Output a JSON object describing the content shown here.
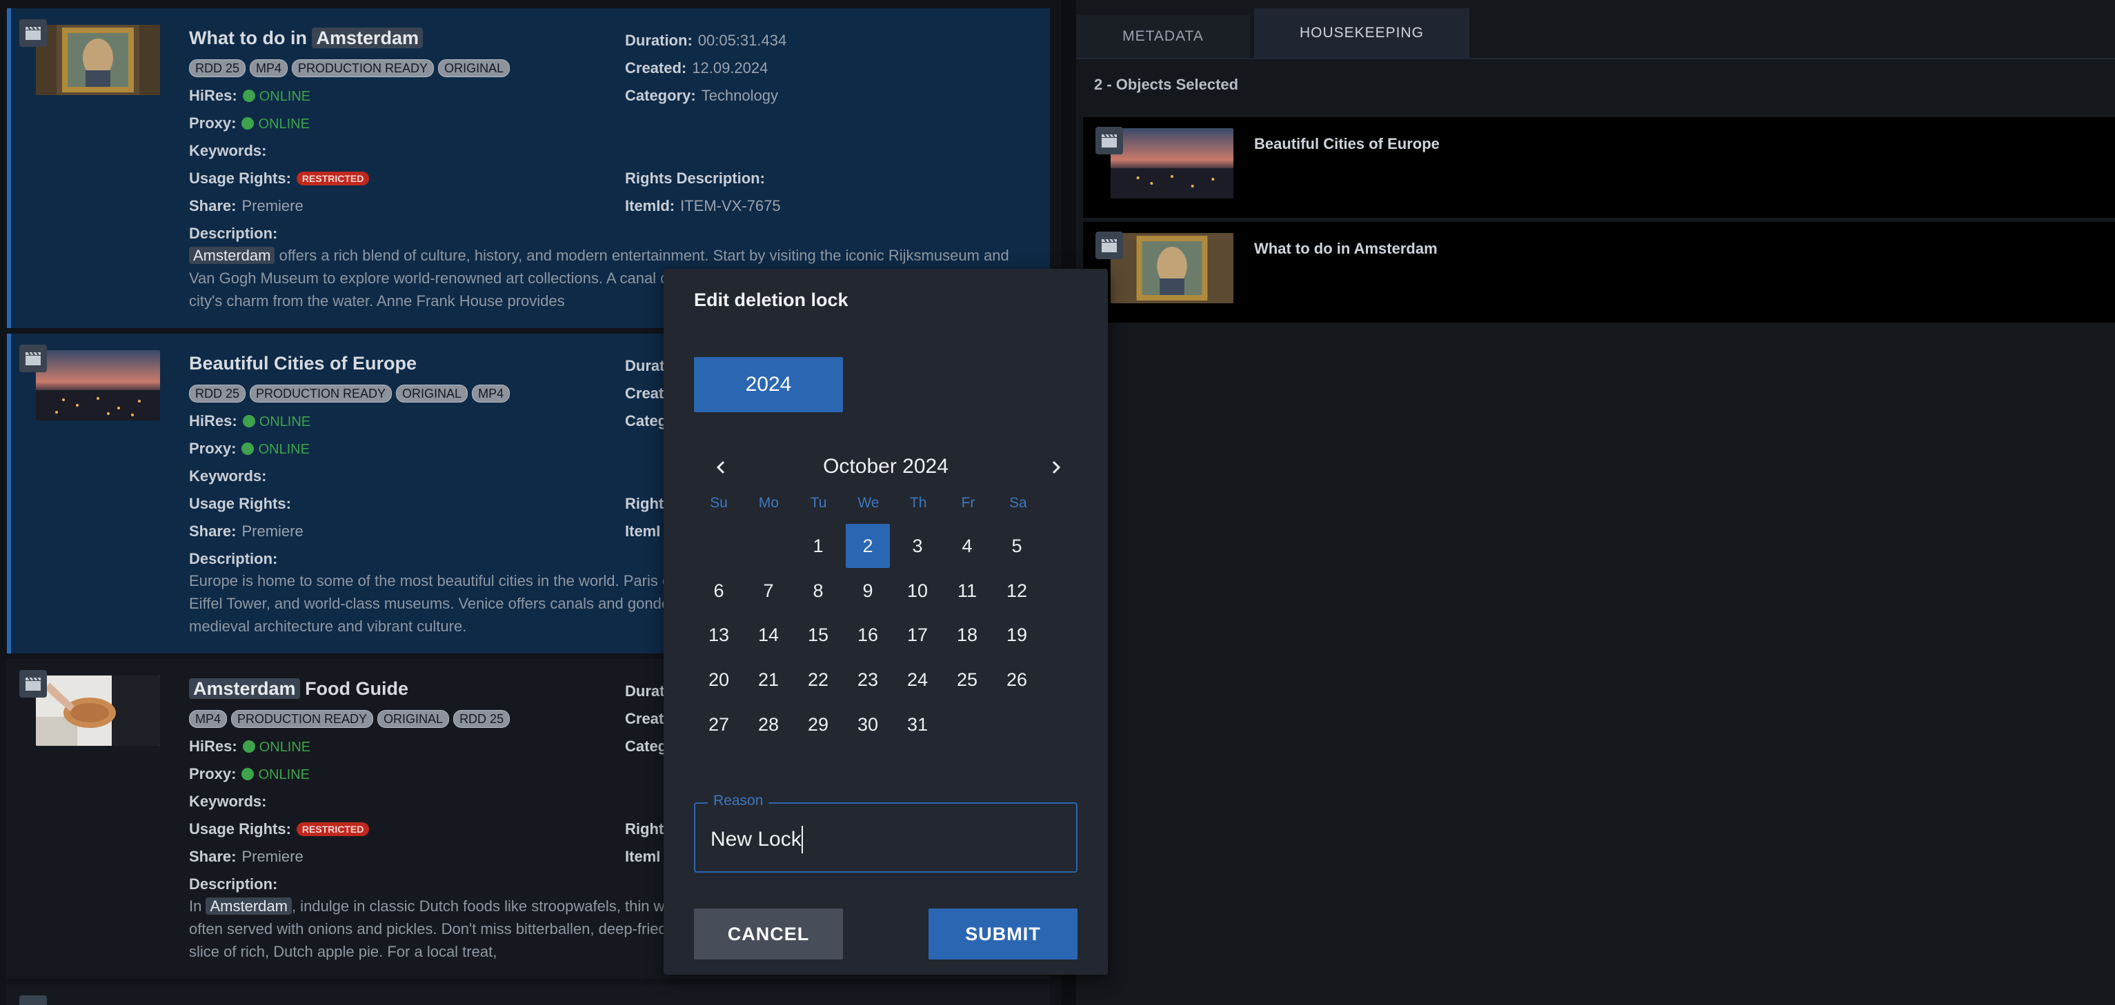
{
  "results": [
    {
      "title_highlight": "Amsterdam",
      "title_pre": "What to do in ",
      "title_post": "",
      "tags": [
        "RDD 25",
        "MP4",
        "PRODUCTION READY",
        "ORIGINAL"
      ],
      "hires_label": "HiRes:",
      "hires_status": "ONLINE",
      "proxy_label": "Proxy:",
      "proxy_status": "ONLINE",
      "keywords_label": "Keywords:",
      "usage_label": "Usage Rights:",
      "usage_badge": "RESTRICTED",
      "share_label": "Share:",
      "share_value": "Premiere",
      "description_label": "Description:",
      "description_highlight": "Amsterdam",
      "description": " offers a rich blend of culture, history, and modern entertainment. Start by visiting the iconic Rijksmuseum and Van Gogh Museum to explore world-renowned art collections. A canal cruise is a must for anyone wanting to experience the city's charm from the water. Anne Frank House provides",
      "duration_label": "Duration:",
      "duration": "00:05:31.434",
      "created_label": "Created:",
      "created": "12.09.2024",
      "category_label": "Category:",
      "category": "Technology",
      "rights_desc_label": "Rights Description:",
      "itemid_label": "ItemId:",
      "itemid": "ITEM-VX-7675"
    },
    {
      "title_pre": "Beautiful Cities of Europe",
      "tags": [
        "RDD 25",
        "PRODUCTION READY",
        "ORIGINAL",
        "MP4"
      ],
      "hires_label": "HiRes:",
      "hires_status": "ONLINE",
      "proxy_label": "Proxy:",
      "proxy_status": "ONLINE",
      "keywords_label": "Keywords:",
      "usage_label": "Usage Rights:",
      "share_label": "Share:",
      "share_value": "Premiere",
      "description_label": "Description:",
      "description": "Europe is home to some of the most beautiful cities in the world. Paris enchants visitors with romantic landmarks like the Eiffel Tower, and world-class museums. Venice offers canals and gondola rides, while Prague captivates visitors with its medieval architecture and vibrant culture.",
      "duration_label": "Durat",
      "created_label": "Creat",
      "category_label": "Categ",
      "rights_label": "Rights",
      "itemid_label": "ItemI"
    },
    {
      "title_highlight": "Amsterdam",
      "title_post": " Food Guide",
      "tags": [
        "MP4",
        "PRODUCTION READY",
        "ORIGINAL",
        "RDD 25"
      ],
      "hires_label": "HiRes:",
      "hires_status": "ONLINE",
      "proxy_label": "Proxy:",
      "proxy_status": "ONLINE",
      "keywords_label": "Keywords:",
      "usage_label": "Usage Rights:",
      "usage_badge": "RESTRICTED",
      "share_label": "Share:",
      "share_value": "Premiere",
      "description_label": "Description:",
      "description_pre": "In ",
      "description_highlight": "Amsterdam",
      "description": ", indulge in classic Dutch foods like stroopwafels, thin waffles filled with caramel syrup, or try raw herring, often served with onions and pickles. Don't miss bitterballen, deep-fried meatballs served with mustard, and finish with a slice of rich, Dutch apple pie. For a local treat,",
      "duration_label": "Durat",
      "created_label": "Creat",
      "category_label": "Categ",
      "rights_label": "Rights",
      "itemid_label": "ItemI"
    }
  ],
  "right_panel": {
    "tabs": [
      "METADATA",
      "HOUSEKEEPING"
    ],
    "active_tab": "HOUSEKEEPING",
    "selection_count": "2 - Objects Selected",
    "selected_items": [
      "Beautiful Cities of Europe",
      "What to do in Amsterdam"
    ]
  },
  "dialog": {
    "title": "Edit deletion lock",
    "year": "2024",
    "month_title": "October 2024",
    "weekdays": [
      "Su",
      "Mo",
      "Tu",
      "We",
      "Th",
      "Fr",
      "Sa"
    ],
    "weeks": [
      [
        "",
        "",
        "1",
        "2",
        "3",
        "4",
        "5"
      ],
      [
        "6",
        "7",
        "8",
        "9",
        "10",
        "11",
        "12"
      ],
      [
        "13",
        "14",
        "15",
        "16",
        "17",
        "18",
        "19"
      ],
      [
        "20",
        "21",
        "22",
        "23",
        "24",
        "25",
        "26"
      ],
      [
        "27",
        "28",
        "29",
        "30",
        "31",
        "",
        ""
      ]
    ],
    "selected_day": "2",
    "reason_label": "Reason",
    "reason_value": "New Lock",
    "cancel_label": "CANCEL",
    "submit_label": "SUBMIT"
  },
  "colors": {
    "accent": "#2b66b3",
    "selected_row": "#0e2a47",
    "online": "#3fa34d",
    "restricted": "#c0281e"
  },
  "icons": [
    "clapperboard-icon",
    "chevron-left-icon",
    "chevron-right-icon"
  ]
}
